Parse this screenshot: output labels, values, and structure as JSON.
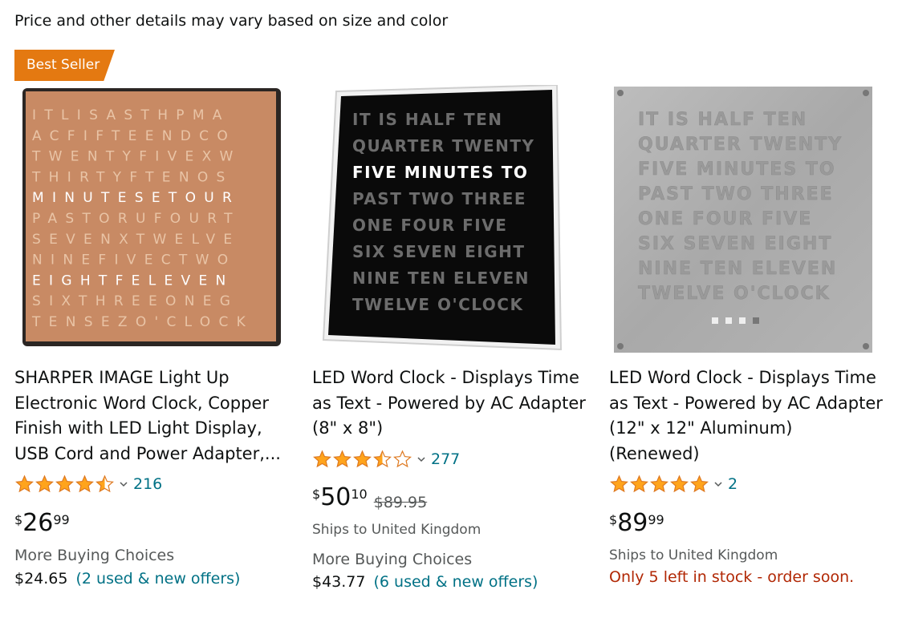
{
  "header": {
    "note": "Price and other details may vary based on size and color"
  },
  "badge": {
    "label": "Best Seller"
  },
  "products": [
    {
      "title": "SHARPER IMAGE Light Up Electronic Word Clock, Copper Finish with LED Light Display, USB Cord and Power Adapter,...",
      "rating": 4.5,
      "rating_count": "216",
      "price_symbol": "$",
      "price_whole": "26",
      "price_fraction": "99",
      "more_buying_label": "More Buying Choices",
      "more_buying_price": "$24.65",
      "more_buying_link": "(2 used & new offers)",
      "clock_rows": [
        "ITLISASTHPMA",
        "ACFIFTEENDCO",
        "TWENTYFIVEXW",
        "THIRTYFTENOS",
        "MINUTESETOUR",
        "PASTORUFOURT",
        "SEVENXTWELVE",
        "NINEFIVECTWO",
        "EIGHTFELEVEN",
        "SIXTHREEONEG",
        "TENSEZO'CLOCK"
      ]
    },
    {
      "title": "LED Word Clock - Displays Time as Text - Powered by AC Adapter (8\" x 8\")",
      "rating": 3.5,
      "rating_count": "277",
      "price_symbol": "$",
      "price_whole": "50",
      "price_fraction": "10",
      "list_price": "$89.95",
      "ships_to": "Ships to United Kingdom",
      "more_buying_label": "More Buying Choices",
      "more_buying_price": "$43.77",
      "more_buying_link": "(6 used & new offers)",
      "clock_rows": [
        "IT IS HALF TEN",
        "QUARTER TWENTY",
        "FIVE MINUTES TO",
        "PAST TWO THREE",
        "ONE FOUR FIVE",
        "SIX SEVEN EIGHT",
        "NINE TEN ELEVEN",
        "TWELVE O'CLOCK"
      ]
    },
    {
      "title": "LED Word Clock - Displays Time as Text - Powered by AC Adapter (12\" x 12\" Aluminum) (Renewed)",
      "rating": 5,
      "rating_count": "2",
      "price_symbol": "$",
      "price_whole": "89",
      "price_fraction": "99",
      "ships_to": "Ships to United Kingdom",
      "stock_note": "Only 5 left in stock - order soon.",
      "clock_rows": [
        "IT IS HALF TEN",
        "QUARTER TWENTY",
        "FIVE MINUTES TO",
        "PAST TWO THREE",
        "ONE FOUR FIVE",
        "SIX SEVEN EIGHT",
        "NINE TEN ELEVEN",
        "TWELVE O'CLOCK"
      ]
    }
  ],
  "colors": {
    "badge": "#e47911",
    "link": "#007185",
    "star": "#ffa41c",
    "stock": "#b12704",
    "muted": "#565959"
  }
}
